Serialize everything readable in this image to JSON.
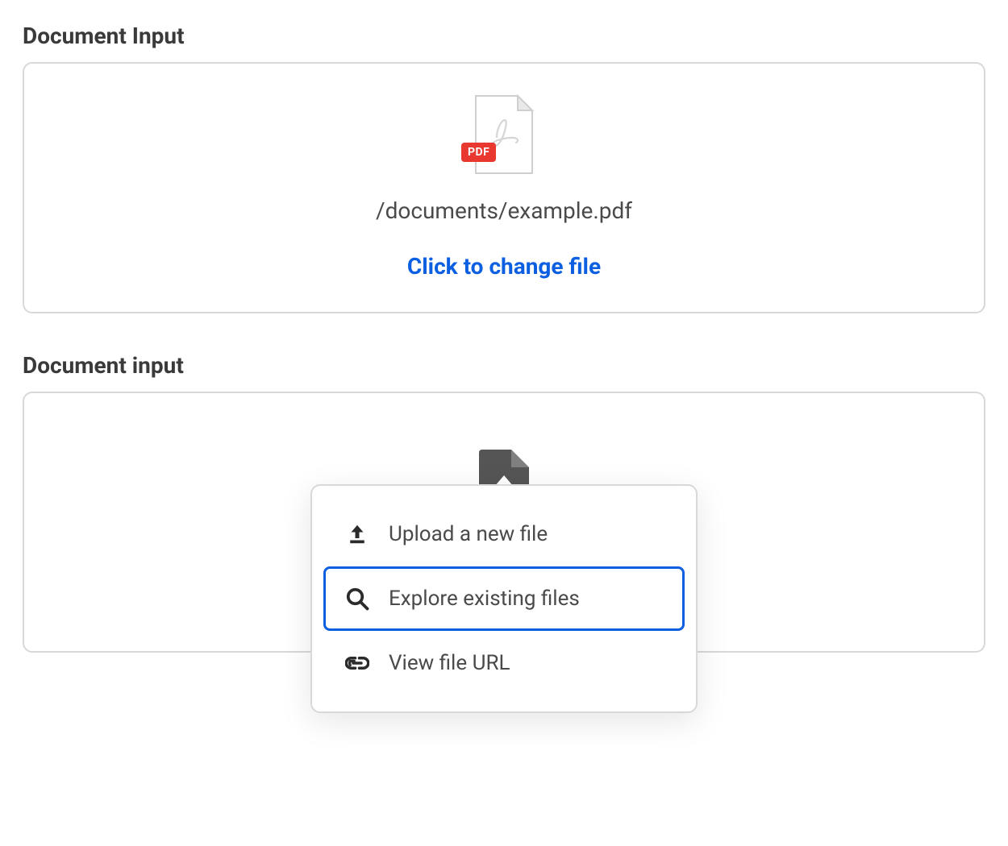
{
  "section1": {
    "label": "Document Input",
    "badge": "PDF",
    "file_path": "/documents/example.pdf",
    "change_link": "Click to change file"
  },
  "section2": {
    "label": "Document input",
    "menu": {
      "upload": "Upload a new file",
      "explore": "Explore existing files",
      "view_url": "View file URL"
    }
  }
}
